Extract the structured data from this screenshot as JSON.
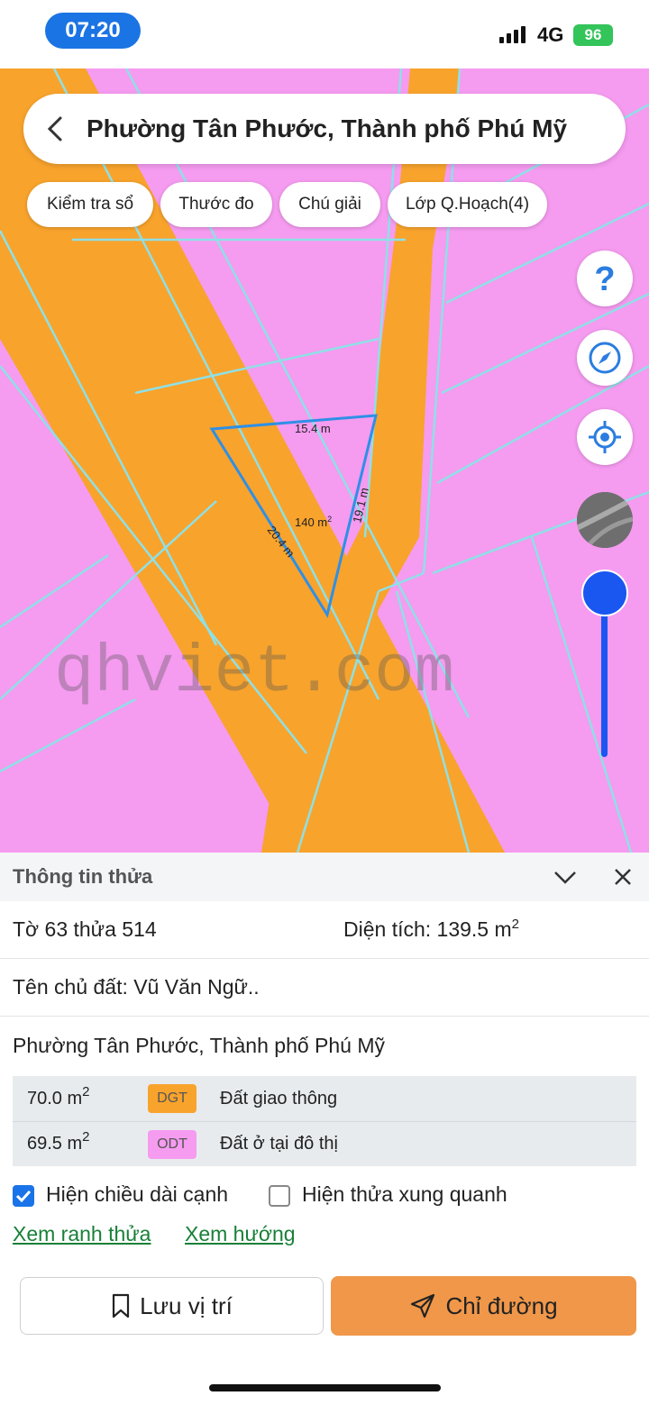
{
  "status": {
    "time": "07:20",
    "network": "4G",
    "battery": "96"
  },
  "header": {
    "title": "Phường Tân Phước, Thành phố Phú Mỹ"
  },
  "chips": [
    "Kiểm tra sổ",
    "Thước đo",
    "Chú giải",
    "Lớp Q.Hoạch(4)"
  ],
  "map": {
    "edge_labels": [
      "15.4 m",
      "19.1 m",
      "20.4 m"
    ],
    "area_label": "140 m",
    "area_unit_sup": "2",
    "watermark": "qhviet.com",
    "colors": {
      "residential": "#f59bf0",
      "road": "#f8a32c",
      "parcel_lines": "#8fe0e6",
      "selection": "#2f8fe6"
    }
  },
  "panel": {
    "title": "Thông tin thửa",
    "sheet_parcel": "Tờ 63 thửa 514",
    "area": "Diện tích: 139.5 m",
    "area_sup": "2",
    "owner": "Tên chủ đất: Vũ Văn Ngữ..",
    "address": "Phường Tân Phước, Thành phố Phú Mỹ",
    "land_uses": [
      {
        "area": "70.0 m",
        "sup": "2",
        "code": "DGT",
        "name": "Đất giao thông",
        "color": "#f8a32c"
      },
      {
        "area": "69.5 m",
        "sup": "2",
        "code": "ODT",
        "name": "Đất ở tại đô thị",
        "color": "#f59bf0"
      }
    ],
    "show_edge_lengths": "Hiện chiều dài cạnh",
    "show_edge_lengths_checked": true,
    "show_neighbors": "Hiện thửa xung quanh",
    "show_neighbors_checked": false,
    "link_boundary": "Xem ranh thửa",
    "link_direction": "Xem hướng",
    "save_label": "Lưu vị trí",
    "directions_label": "Chỉ đường"
  }
}
